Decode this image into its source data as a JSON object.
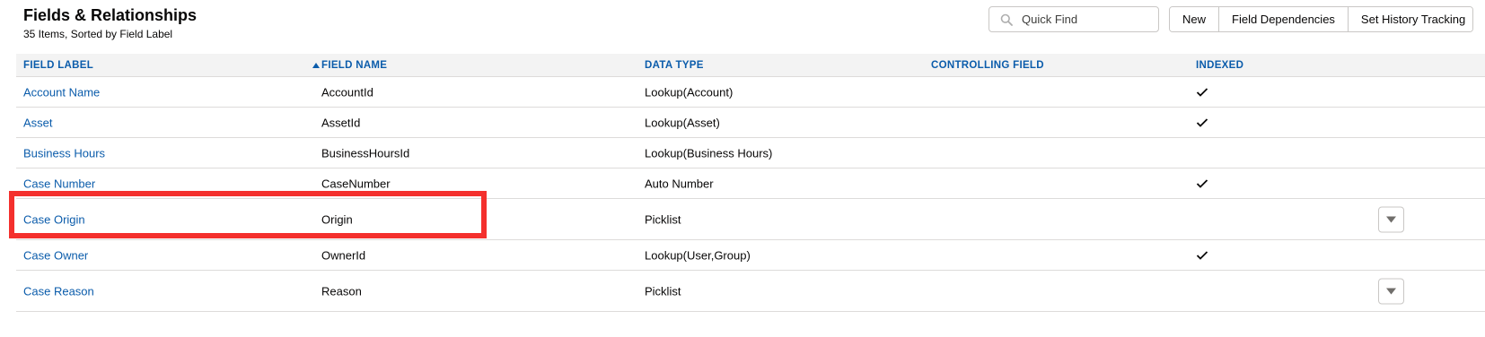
{
  "header": {
    "title": "Fields & Relationships",
    "subtitle": "35 Items, Sorted by Field Label"
  },
  "search": {
    "placeholder": "Quick Find",
    "icon": "search-icon"
  },
  "toolbar": {
    "new_label": "New",
    "field_dependencies_label": "Field Dependencies",
    "set_history_tracking_label": "Set History Tracking"
  },
  "table": {
    "columns": [
      "FIELD LABEL",
      "FIELD NAME",
      "DATA TYPE",
      "CONTROLLING FIELD",
      "INDEXED"
    ],
    "sort": {
      "column": "FIELD LABEL",
      "direction": "ascending"
    },
    "rows": [
      {
        "label": "Account Name",
        "name": "AccountId",
        "type": "Lookup(Account)",
        "controlling": "",
        "indexed": true,
        "menu": false
      },
      {
        "label": "Asset",
        "name": "AssetId",
        "type": "Lookup(Asset)",
        "controlling": "",
        "indexed": true,
        "menu": false
      },
      {
        "label": "Business Hours",
        "name": "BusinessHoursId",
        "type": "Lookup(Business Hours)",
        "controlling": "",
        "indexed": false,
        "menu": false
      },
      {
        "label": "Case Number",
        "name": "CaseNumber",
        "type": "Auto Number",
        "controlling": "",
        "indexed": true,
        "menu": false
      },
      {
        "label": "Case Origin",
        "name": "Origin",
        "type": "Picklist",
        "controlling": "",
        "indexed": false,
        "menu": true,
        "highlighted": true
      },
      {
        "label": "Case Owner",
        "name": "OwnerId",
        "type": "Lookup(User,Group)",
        "controlling": "",
        "indexed": true,
        "menu": false
      },
      {
        "label": "Case Reason",
        "name": "Reason",
        "type": "Picklist",
        "controlling": "",
        "indexed": false,
        "menu": true
      }
    ]
  },
  "colors": {
    "link": "#0b5cab",
    "header_bg": "#f3f3f3",
    "border": "#dddbda",
    "highlight": "#f4302d"
  }
}
